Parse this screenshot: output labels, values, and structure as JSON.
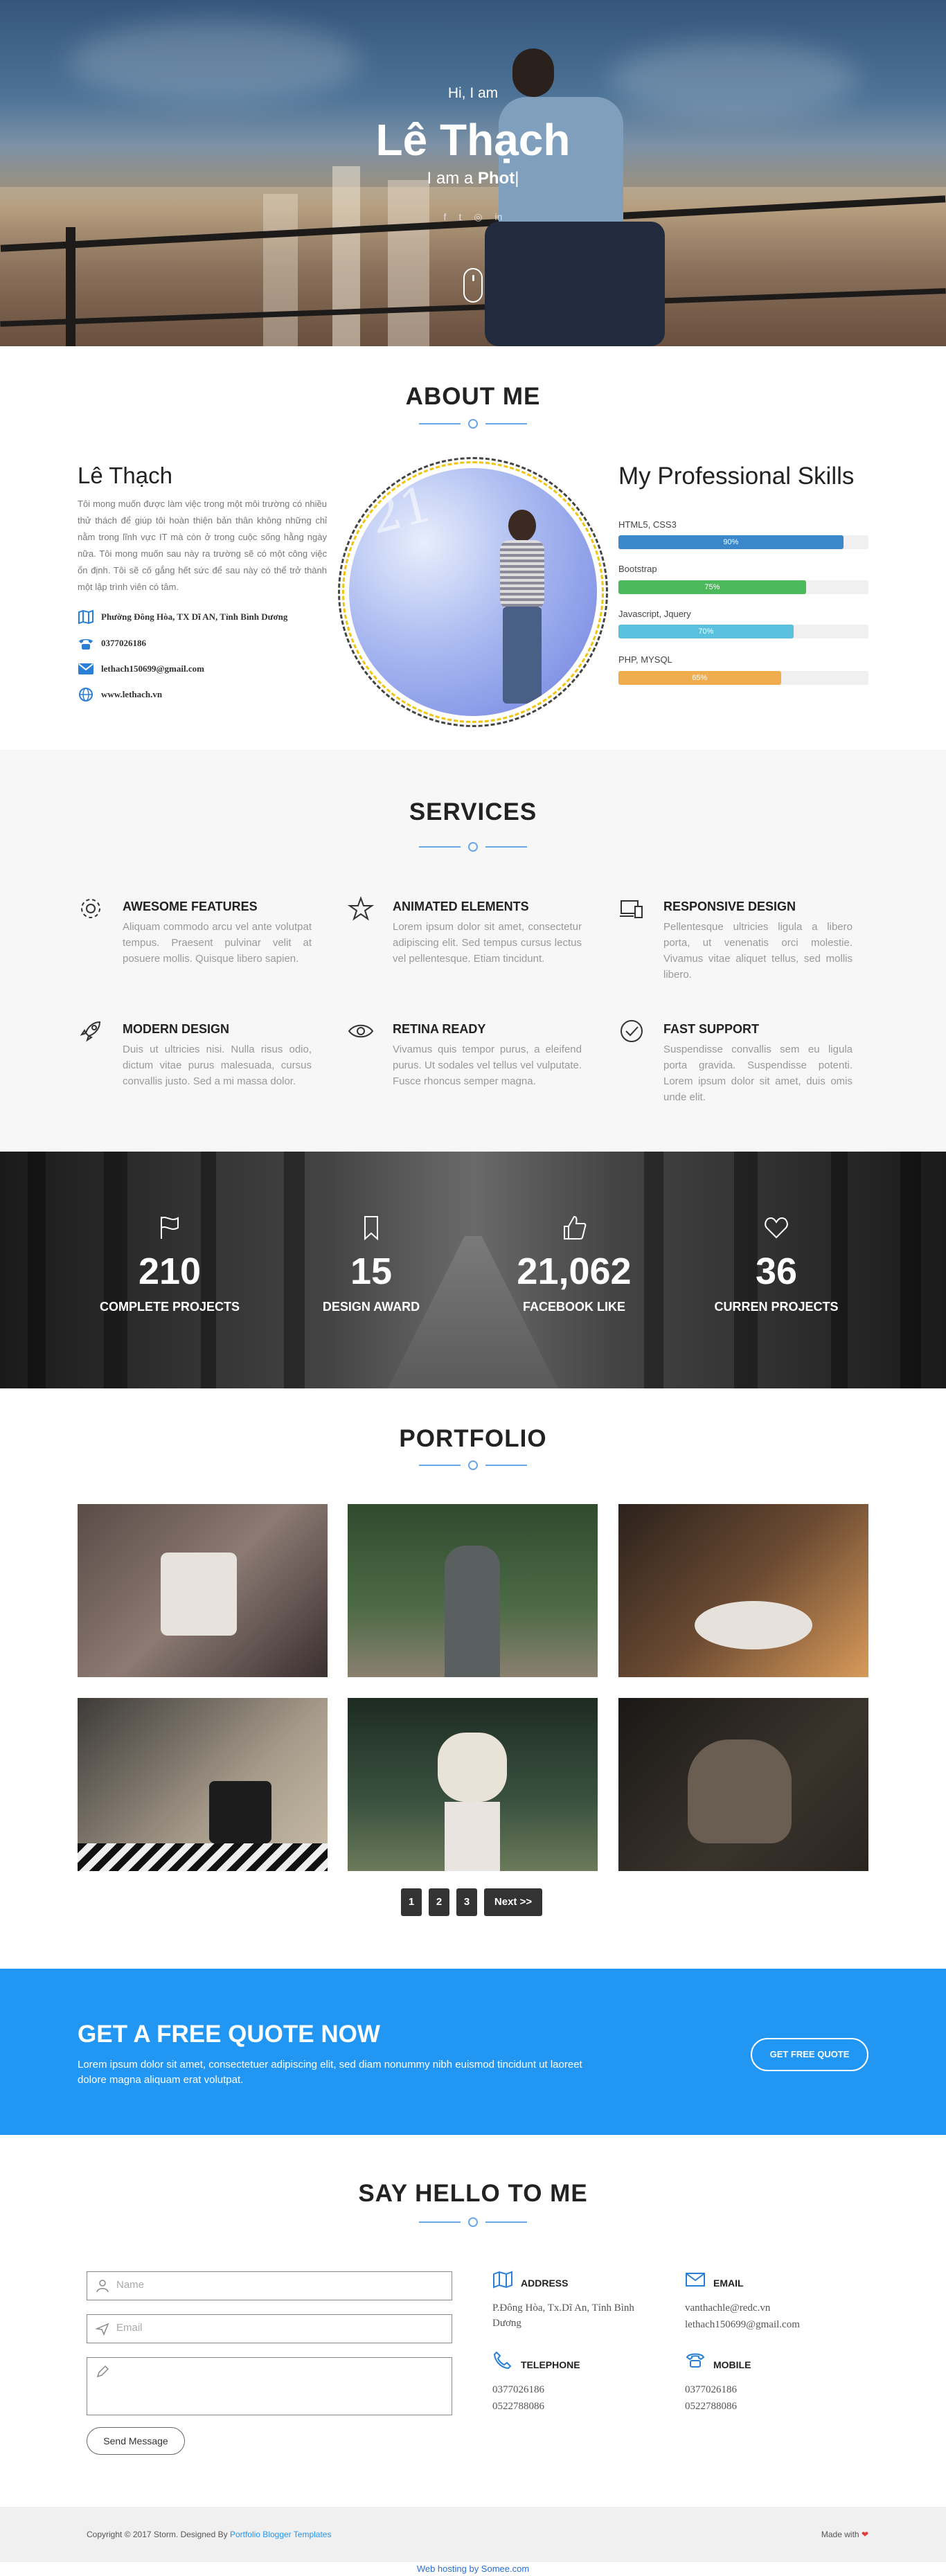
{
  "hero": {
    "greeting": "Hi, I am",
    "name": "Lê Thạch",
    "role_prefix": "I am a ",
    "role_typed": "Phot",
    "role_cursor": "|"
  },
  "about": {
    "title": "ABOUT ME",
    "name": "Lê Thạch",
    "text": "Tôi mong muốn được làm việc trong một môi trường có nhiều thử thách để giúp tôi hoàn thiện bản thân không những chỉ nằm trong lĩnh vực IT mà còn ở trong cuộc sống hằng ngày nữa. Tôi mong muốn sau này ra trường sẽ có một công việc ổn định. Tôi sẽ cố gắng hết sức để sau này có thể trở thành một lập trình viên có tâm.",
    "contacts": [
      {
        "icon": "map-icon",
        "text": "Phường Đông Hòa, TX Dĩ AN, Tỉnh Bình Dương"
      },
      {
        "icon": "phone-icon",
        "text": "0377026186"
      },
      {
        "icon": "email-icon",
        "text": "lethach150699@gmail.com"
      },
      {
        "icon": "globe-icon",
        "text": "www.lethach.vn"
      }
    ]
  },
  "skills": {
    "title": "My Professional Skills",
    "items": [
      {
        "label": "HTML5, CSS3",
        "percent": 90,
        "percent_label": "90%",
        "color": "#3a87c9"
      },
      {
        "label": "Bootstrap",
        "percent": 75,
        "percent_label": "75%",
        "color": "#4cb85c"
      },
      {
        "label": "Javascript, Jquery",
        "percent": 70,
        "percent_label": "70%",
        "color": "#5bc0de"
      },
      {
        "label": "PHP, MYSQL",
        "percent": 65,
        "percent_label": "65%",
        "color": "#f0ad4e"
      }
    ]
  },
  "services": {
    "title": "SERVICES",
    "items": [
      {
        "icon": "gear-icon",
        "title": "AWESOME FEATURES",
        "text": "Aliquam commodo arcu vel ante volutpat tempus. Praesent pulvinar velit at posuere mollis. Quisque libero sapien."
      },
      {
        "icon": "star-icon",
        "title": "ANIMATED ELEMENTS",
        "text": "Lorem ipsum dolor sit amet, consectetur adipiscing elit. Sed tempus cursus lectus vel pellentesque. Etiam tincidunt."
      },
      {
        "icon": "devices-icon",
        "title": "RESPONSIVE DESIGN",
        "text": "Pellentesque ultricies ligula a libero porta, ut venenatis orci molestie. Vivamus vitae aliquet tellus, sed mollis libero."
      },
      {
        "icon": "rocket-icon",
        "title": "MODERN DESIGN",
        "text": "Duis ut ultricies nisi. Nulla risus odio, dictum vitae purus malesuada, cursus convallis justo. Sed a mi massa dolor."
      },
      {
        "icon": "eye-icon",
        "title": "RETINA READY",
        "text": "Vivamus quis tempor purus, a eleifend purus. Ut sodales vel tellus vel vulputate. Fusce rhoncus semper magna."
      },
      {
        "icon": "check-circle-icon",
        "title": "FAST SUPPORT",
        "text": "Suspendisse convallis sem eu ligula porta gravida. Suspendisse potenti. Lorem ipsum dolor sit amet, duis omis unde elit."
      }
    ]
  },
  "counters": [
    {
      "icon": "flag-icon",
      "value": "210",
      "label": "COMPLETE PROJECTS"
    },
    {
      "icon": "bookmark-icon",
      "value": "15",
      "label": "DESIGN AWARD"
    },
    {
      "icon": "thumbs-up-icon",
      "value": "21,062",
      "label": "FACEBOOK LIKE"
    },
    {
      "icon": "heart-icon",
      "value": "36",
      "label": "CURREN PROJECTS"
    }
  ],
  "portfolio": {
    "title": "PORTFOLIO",
    "pages": [
      "1",
      "2",
      "3"
    ],
    "next": "Next >>"
  },
  "quote": {
    "title": "GET A FREE QUOTE NOW",
    "text": "Lorem ipsum dolor sit amet, consectetuer adipiscing elit, sed diam nonummy nibh euismod tincidunt ut laoreet dolore magna aliquam erat volutpat.",
    "button": "GET FREE QUOTE"
  },
  "contact": {
    "title": "SAY HELLO TO ME",
    "name_placeholder": "Name",
    "email_placeholder": "Email",
    "send": "Send Message",
    "address_title": "ADDRESS",
    "address_text": "P.Đông Hòa, Tx.Dĩ An, Tỉnh Bình Dương",
    "email_title": "EMAIL",
    "email_1": "vanthachle@redc.vn",
    "email_2": "lethach150699@gmail.com",
    "telephone_title": "TELEPHONE",
    "telephone_1": "0377026186",
    "telephone_2": "0522788086",
    "mobile_title": "MOBILE",
    "mobile_1": "0377026186",
    "mobile_2": "0522788086"
  },
  "footer": {
    "copy_prefix": "Copyright © 2017 Storm. Designed By ",
    "copy_link": "Portfolio Blogger Templates",
    "made_with": "Made with",
    "heart": "❤",
    "hosting": "Web hosting by Somee.com"
  }
}
